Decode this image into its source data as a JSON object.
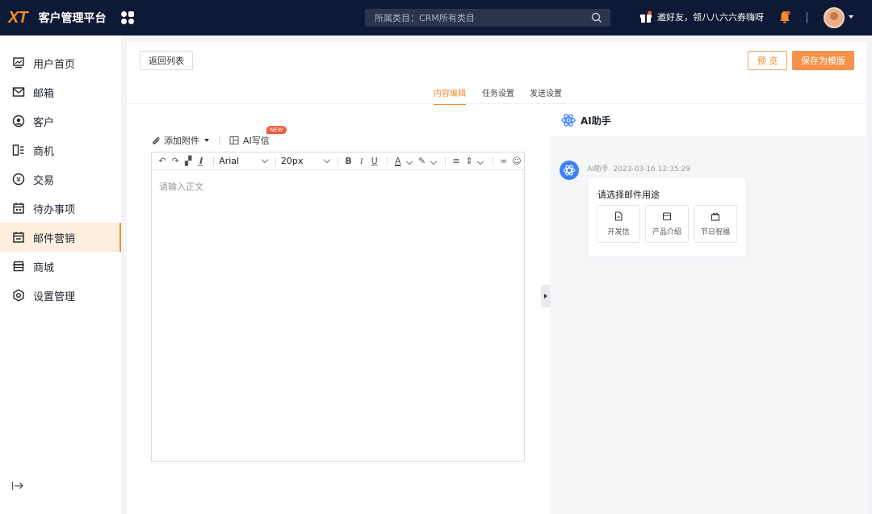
{
  "topbar": {
    "logo": "XT",
    "title": "客户管理平台",
    "search_text": "所属类目：CRM所有类目",
    "promo": "邀好友，领八八六六券嗨呀"
  },
  "sidebar": {
    "items": [
      {
        "label": "用户首页",
        "icon": "home-monitor-icon"
      },
      {
        "label": "邮箱",
        "icon": "mail-icon"
      },
      {
        "label": "客户",
        "icon": "customer-icon"
      },
      {
        "label": "商机",
        "icon": "opportunity-icon"
      },
      {
        "label": "交易",
        "icon": "trade-icon"
      },
      {
        "label": "待办事项",
        "icon": "calendar-icon"
      },
      {
        "label": "邮件营销",
        "icon": "email-marketing-icon",
        "active": true
      },
      {
        "label": "商城",
        "icon": "store-icon"
      },
      {
        "label": "设置管理",
        "icon": "gear-icon"
      }
    ]
  },
  "main": {
    "back_label": "返回列表",
    "preview_label": "预 览",
    "save_label": "保存为模版",
    "tabs": [
      {
        "label": "内容编辑",
        "active": true
      },
      {
        "label": "任务设置"
      },
      {
        "label": "发送设置"
      }
    ],
    "attach_label": "添加附件",
    "ai_write_label": "AI写信",
    "new_badge": "NEW",
    "toolbar": {
      "font": "Arial",
      "size": "20px"
    },
    "editor_placeholder": "请输入正文"
  },
  "ai_panel": {
    "title": "AI助手",
    "sender": "AI助手",
    "time": "2023-03-16 12:35:29",
    "prompt": "请选择邮件用途",
    "options": [
      "开发信",
      "产品介绍",
      "节日祝福"
    ]
  },
  "colors": {
    "accent": "#f58b2c",
    "topbar_bg": "#0e1a35",
    "ai_blue": "#3b82f6"
  }
}
